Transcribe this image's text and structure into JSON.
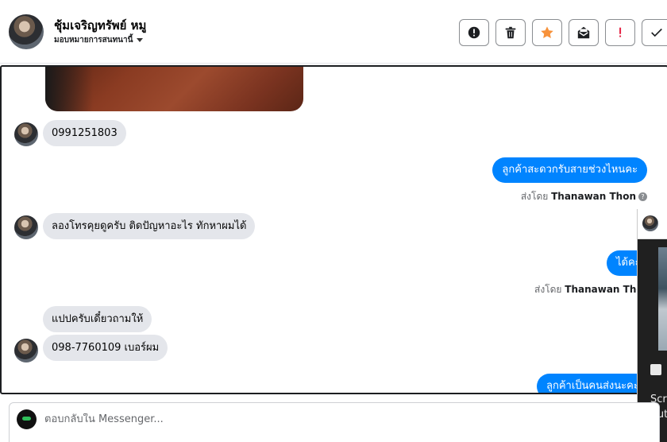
{
  "header": {
    "contact_name": "ชุ้มเจริญทรัพย์ หมู",
    "assign_label": "มอบหมายการสนทนานี้",
    "buttons": [
      {
        "name": "spam-button",
        "icon": "alert-circle-icon"
      },
      {
        "name": "delete-button",
        "icon": "trash-icon"
      },
      {
        "name": "star-button",
        "icon": "star-icon",
        "color": "#f7923b"
      },
      {
        "name": "mark-unread-button",
        "icon": "envelope-icon"
      },
      {
        "name": "follow-up-button",
        "icon": "exclamation-icon",
        "color": "#e41e3f"
      },
      {
        "name": "mark-done-button",
        "icon": "check-icon"
      }
    ]
  },
  "messages": [
    {
      "side": "in",
      "text": "0991251803"
    },
    {
      "side": "out",
      "text": "ลูกค้าสะดวกรับสายช่วงไหนคะ",
      "sent_by_label": "ส่งโดย",
      "sent_by_name": "Thanawan Thon"
    },
    {
      "side": "in",
      "text": "ลองโทรคุยดูครับ ติดปัญหาอะไร ทักหาผมได้"
    },
    {
      "side": "out",
      "text": "ได้คะ",
      "sent_by_label": "ส่งโดย",
      "sent_by_name": "Thanawan Thon"
    },
    {
      "side": "in",
      "text": "แปปครับเดี๋ยวถามให้"
    },
    {
      "side": "in",
      "text": "098-7760109 เบอร์ผม"
    },
    {
      "side": "out",
      "text": "ลูกค้าเป็นคนส่งนะคะ"
    }
  ],
  "overlay": {
    "line1": "Scre",
    "line2": "Aut"
  },
  "composer": {
    "placeholder": "ตอบกลับใน Messenger..."
  },
  "colors": {
    "accent": "#0084ff",
    "incoming_bubble": "#e4e6eb",
    "star": "#f7923b",
    "alert": "#e41e3f"
  }
}
